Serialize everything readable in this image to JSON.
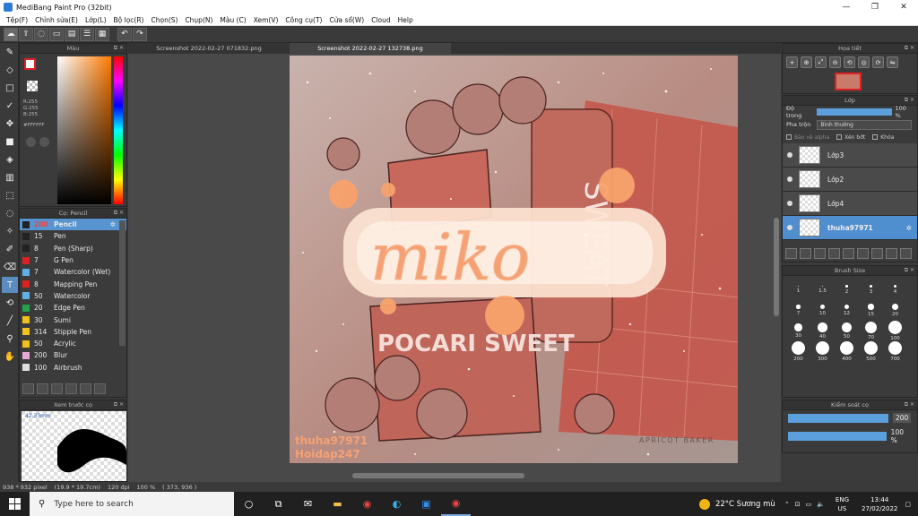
{
  "window": {
    "title": "MediBang Paint Pro (32bit)",
    "minimize": "—",
    "maximize": "❐",
    "close": "✕"
  },
  "menu": [
    "Tệp(F)",
    "Chỉnh sửa(E)",
    "Lớp(L)",
    "Bộ lọc(R)",
    "Chọn(S)",
    "Chụp(N)",
    "Màu (C)",
    "Xem(V)",
    "Công cụ(T)",
    "Cửa sổ(W)",
    "Cloud",
    "Help"
  ],
  "color_panel": {
    "title": "Màu",
    "r": "R:255",
    "g": "G:255",
    "b": "B:255",
    "hex": "#FFFFFF",
    "colors": {
      "foreground": "#ffffff",
      "outline": "#e21f1f",
      "hue": "#ff7a00"
    }
  },
  "brush_panel": {
    "title": "Cọ: Pencil",
    "items": [
      {
        "size": "200",
        "name": "Pencil",
        "color": "#222222",
        "selected": true
      },
      {
        "size": "15",
        "name": "Pen",
        "color": "#222222"
      },
      {
        "size": "8",
        "name": "Pen (Sharp)",
        "color": "#222222"
      },
      {
        "size": "7",
        "name": "G Pen",
        "color": "#e02020"
      },
      {
        "size": "7",
        "name": "Watercolor (Wet)",
        "color": "#5fb0e6"
      },
      {
        "size": "8",
        "name": "Mapping Pen",
        "color": "#e02020"
      },
      {
        "size": "50",
        "name": "Watercolor",
        "color": "#5fb0e6"
      },
      {
        "size": "20",
        "name": "Edge Pen",
        "color": "#23a24a"
      },
      {
        "size": "30",
        "name": "Sumi",
        "color": "#f2c21a"
      },
      {
        "size": "314",
        "name": "Stipple Pen",
        "color": "#f2c21a"
      },
      {
        "size": "50",
        "name": "Acrylic",
        "color": "#f2c21a"
      },
      {
        "size": "200",
        "name": "Blur",
        "color": "#e8a8d8"
      },
      {
        "size": "100",
        "name": "Airbrush",
        "color": "#dddddd"
      }
    ]
  },
  "preview_panel": {
    "title": "Xem trước cọ",
    "size": "42.33mm"
  },
  "canvas": {
    "tabs": [
      "Screenshot 2022-02-27 071832.png",
      "Screenshot 2022-02-27 132738.png"
    ],
    "art_text": {
      "logo": "miko",
      "brand": "POCARI SWEET",
      "can_text": "SWEAT",
      "watermark": "APRICOT BAKER",
      "credit_1": "thuha97971",
      "credit_2": "Hoidap247"
    }
  },
  "navigator": {
    "title": "Họa tiết"
  },
  "layer_panel": {
    "title": "Lớp",
    "opacity_label": "Độ trong",
    "opacity_value": "100 %",
    "opacity_level": 1.0,
    "blend_label": "Pha trộn",
    "blend_value": "Bình thường",
    "protect_alpha": "Bảo vệ alpha",
    "clipping": "Xén bớt",
    "lock": "Khóa",
    "layers": [
      {
        "name": "Lớp3",
        "selected": false
      },
      {
        "name": "Lớp2",
        "selected": false
      },
      {
        "name": "Lớp4",
        "selected": false
      },
      {
        "name": "thuha97971",
        "selected": true
      }
    ]
  },
  "brush_size_panel": {
    "title": "Brush Size",
    "sizes": [
      "1",
      "1.5",
      "2",
      "3",
      "4",
      "7",
      "10",
      "12",
      "15",
      "20",
      "30",
      "40",
      "50",
      "70",
      "100",
      "200",
      "300",
      "400",
      "500",
      "700"
    ]
  },
  "control_panel": {
    "title": "Kiểm soát cọ",
    "size_value": "200",
    "opacity_value": "100 %"
  },
  "status": {
    "pixel": "938 * 932 pixel",
    "cm": "(19.9 * 19.7cm)",
    "dpi": "120 dpi",
    "zoom": "100 %",
    "coords": "( 373, 936 )"
  },
  "taskbar": {
    "search_placeholder": "Type here to search",
    "weather": "22°C  Sương mù",
    "lang_1": "ENG",
    "lang_2": "US",
    "time": "13:44",
    "date": "27/02/2022"
  }
}
